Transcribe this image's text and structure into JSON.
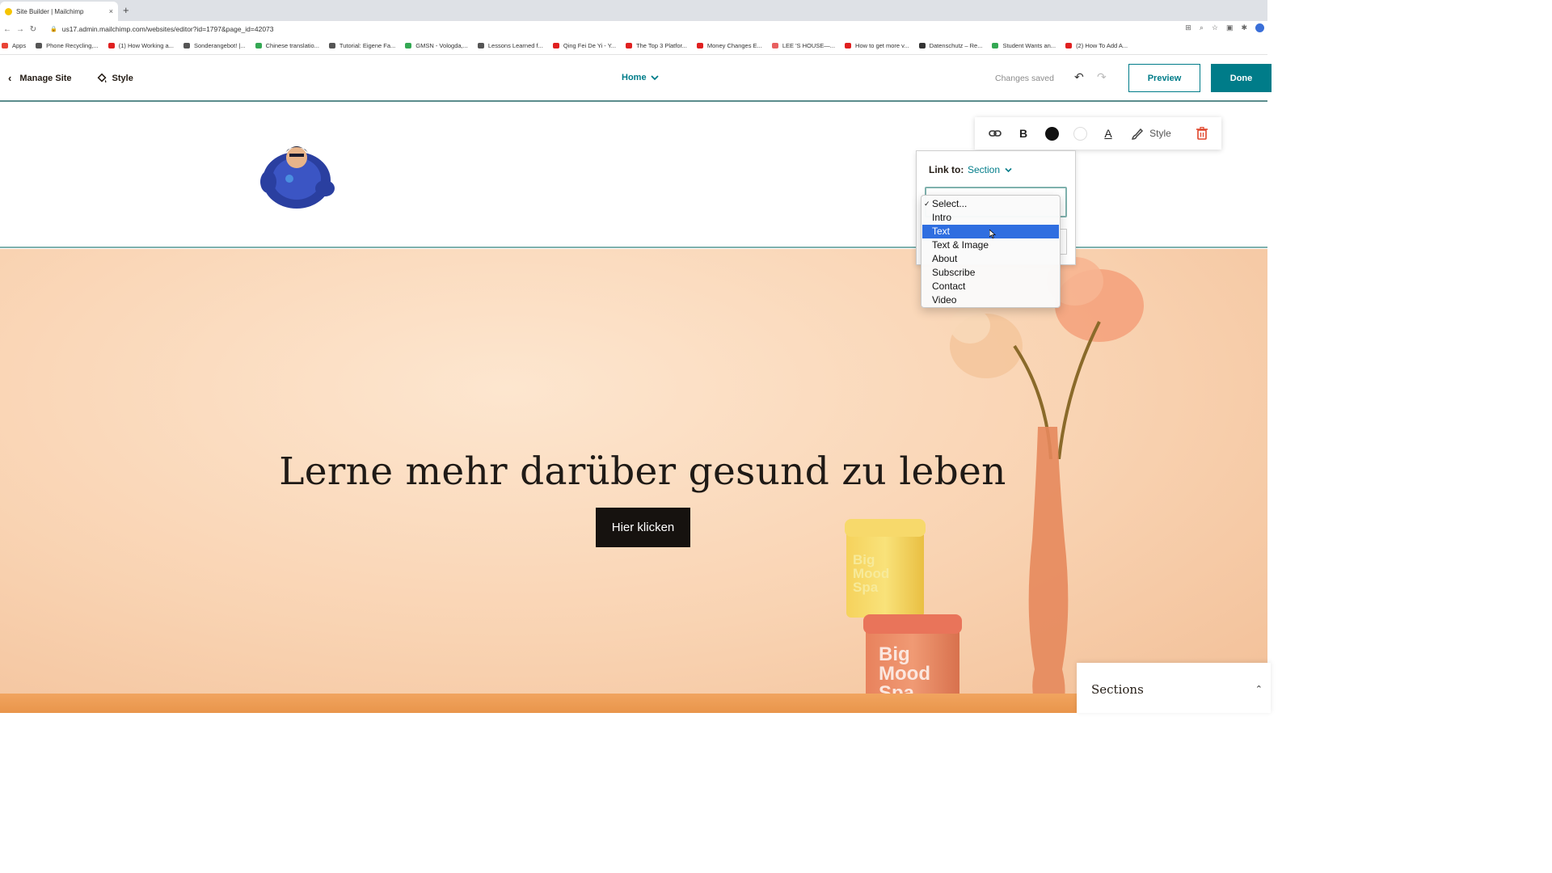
{
  "browser": {
    "tab_title": "Site Builder | Mailchimp",
    "tab_close": "×",
    "new_tab": "+",
    "url": "us17.admin.mailchimp.com/websites/editor?id=1797&page_id=42073",
    "bookmarks": [
      {
        "label": "Apps",
        "color": "#e94335"
      },
      {
        "label": "Phone Recycling,...",
        "color": "#555555"
      },
      {
        "label": "(1) How Working a...",
        "color": "#e02020"
      },
      {
        "label": "Sonderangebot! |...",
        "color": "#555555"
      },
      {
        "label": "Chinese translatio...",
        "color": "#34a853"
      },
      {
        "label": "Tutorial: Eigene Fa...",
        "color": "#555555"
      },
      {
        "label": "GMSN - Vologda,...",
        "color": "#34a853"
      },
      {
        "label": "Lessons Learned f...",
        "color": "#555555"
      },
      {
        "label": "Qing Fei De Yi - Y...",
        "color": "#e02020"
      },
      {
        "label": "The Top 3 Platfor...",
        "color": "#e02020"
      },
      {
        "label": "Money Changes E...",
        "color": "#e02020"
      },
      {
        "label": "LEE 'S HOUSE—...",
        "color": "#e86060"
      },
      {
        "label": "How to get more v...",
        "color": "#e02020"
      },
      {
        "label": "Datenschutz – Re...",
        "color": "#333333"
      },
      {
        "label": "Student Wants an...",
        "color": "#34a853"
      },
      {
        "label": "(2) How To Add A...",
        "color": "#e02020"
      }
    ]
  },
  "editor": {
    "manage_site": "Manage Site",
    "style": "Style",
    "page_selector": "Home",
    "status": "Changes saved",
    "preview": "Preview",
    "done": "Done"
  },
  "toolbar": {
    "bold": "B",
    "font_color": "A",
    "style": "Style"
  },
  "link_panel": {
    "label": "Link to:",
    "type": "Section",
    "options": [
      "Select...",
      "Intro",
      "Text",
      "Text & Image",
      "About",
      "Subscribe",
      "Contact",
      "Video"
    ],
    "checked_option": "Select...",
    "highlighted_option": "Text"
  },
  "hero": {
    "title": "Lerne mehr darüber gesund zu leben",
    "button": "Hier klicken",
    "jar_small_text": "Big Mood Spa",
    "jar_large_text": "Big Mood Spa"
  },
  "sections_panel": {
    "label": "Sections"
  },
  "colors": {
    "accent": "#007c89",
    "highlight": "#2f6ee0",
    "hero_bg": "#f9d3b2"
  }
}
